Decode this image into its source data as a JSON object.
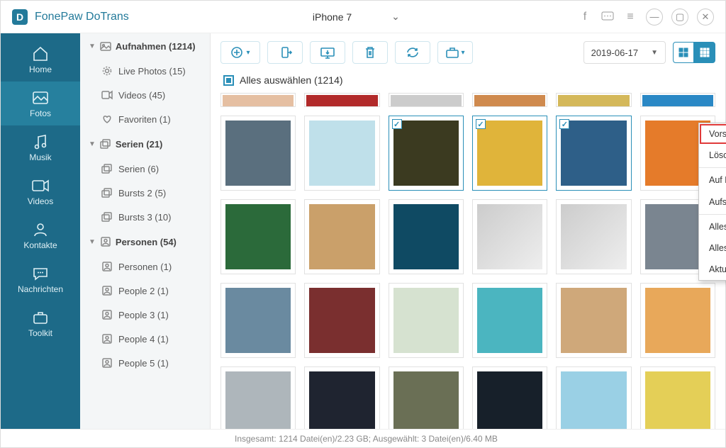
{
  "app": {
    "name": "FonePaw DoTrans",
    "device": "iPhone 7"
  },
  "sidebar": {
    "items": [
      {
        "label": "Home"
      },
      {
        "label": "Fotos"
      },
      {
        "label": "Musik"
      },
      {
        "label": "Videos"
      },
      {
        "label": "Kontakte"
      },
      {
        "label": "Nachrichten"
      },
      {
        "label": "Toolkit"
      }
    ]
  },
  "tree": {
    "groups": [
      {
        "label": "Aufnahmen (1214)",
        "items": [
          {
            "label": "Live Photos (15)"
          },
          {
            "label": "Videos (45)"
          },
          {
            "label": "Favoriten (1)"
          }
        ]
      },
      {
        "label": "Serien (21)",
        "items": [
          {
            "label": "Serien (6)"
          },
          {
            "label": "Bursts 2 (5)"
          },
          {
            "label": "Bursts 3 (10)"
          }
        ]
      },
      {
        "label": "Personen (54)",
        "items": [
          {
            "label": "Personen (1)"
          },
          {
            "label": "People 2 (1)"
          },
          {
            "label": "People 3 (1)"
          },
          {
            "label": "People 4 (1)"
          },
          {
            "label": "People 5 (1)"
          }
        ]
      }
    ]
  },
  "toolbar": {
    "date": "2019-06-17"
  },
  "selectall": {
    "label": "Alles auswählen (1214)"
  },
  "context": {
    "items": [
      "Vorschau",
      "Löschen",
      "Auf PC exportieren",
      "Aufs Gerät übertragen",
      "Alles auswählen",
      "Alles abwählen",
      "Aktualisieren"
    ]
  },
  "status": {
    "text": "Insgesamt: 1214 Datei(en)/2.23 GB;  Ausgewählt: 3 Datei(en)/6.40 MB"
  },
  "thumbs": {
    "row0": [
      "#e5bfa2",
      "#b22a2a",
      "#cccccc",
      "#cf8a4e",
      "#d4b85a",
      "#2a88c5"
    ],
    "rows": [
      [
        {
          "c": "#5a6f7e"
        },
        {
          "c": "#bfe0ea"
        },
        {
          "c": "#3b3a20",
          "sel": true
        },
        {
          "c": "#e0b43a",
          "sel": true
        },
        {
          "c": "#2e5f88",
          "sel": true
        },
        {
          "c": "#e57b2a"
        }
      ],
      [
        {
          "c": "#2b6a3a"
        },
        {
          "c": "#caa06a"
        },
        {
          "c": "#0f4a63"
        },
        {
          "c": ""
        },
        {
          "c": ""
        },
        {
          "c": "#7a8590"
        }
      ],
      [
        {
          "c": "#6a8aa0"
        },
        {
          "c": "#7a2f2f"
        },
        {
          "c": "#d6e2d0"
        },
        {
          "c": "#4bb5c0"
        },
        {
          "c": "#cfa87a"
        },
        {
          "c": "#e8a85a"
        }
      ],
      [
        {
          "c": "#aeb6bb"
        },
        {
          "c": "#1f2430"
        },
        {
          "c": "#6a6f55"
        },
        {
          "c": "#17202a"
        },
        {
          "c": "#9ad0e5"
        },
        {
          "c": "#e4cf57"
        }
      ]
    ]
  }
}
